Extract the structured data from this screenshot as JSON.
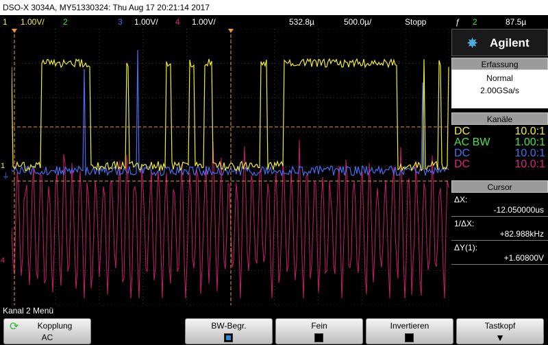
{
  "title": "DSO-X 3034A, MY51330324: Thu Aug 17 20:21:14 2017",
  "status": {
    "ch1": "1",
    "ch1_scale": "1.00V/",
    "ch2": "2",
    "ch3": "3",
    "ch3_scale": "1.00V/",
    "ch4": "4",
    "ch4_scale": "1.00V/",
    "time_delay": "532.8µ",
    "timebase": "500.0µ/",
    "run_state": "Stopp",
    "trig_ch": "2",
    "trig_level": "87.5µ"
  },
  "brand": "Agilent",
  "acquisition": {
    "header": "Erfassung",
    "mode": "Normal",
    "rate": "2.00GSa/s"
  },
  "channels": {
    "header": "Kanäle",
    "rows": [
      {
        "coupling": "DC",
        "probe": "10.0:1",
        "color": "#f2ee3a"
      },
      {
        "coupling": "AC BW",
        "probe": "1.00:1",
        "color": "#46e44a"
      },
      {
        "coupling": "DC",
        "probe": "10.0:1",
        "color": "#4a6df0"
      },
      {
        "coupling": "DC",
        "probe": "10.0:1",
        "color": "#e0207a"
      }
    ]
  },
  "cursor": {
    "header": "Cursor",
    "dx_label": "ΔX:",
    "dx_value": "-12.050000us",
    "inv_label": "1/ΔX:",
    "inv_value": "+82.988kHz",
    "dy_label": "ΔY(1):",
    "dy_value": "+1.60800V"
  },
  "menu_title": "Kanal 2 Menü",
  "softkeys": {
    "k1_label": "Kopplung",
    "k1_value": "AC",
    "k2_label": "BW-Begr.",
    "k3_label": "Fein",
    "k4_label": "Invertieren",
    "k5_label": "Tastkopf"
  },
  "markers": {
    "ch1": "1",
    "ch4": "4"
  }
}
